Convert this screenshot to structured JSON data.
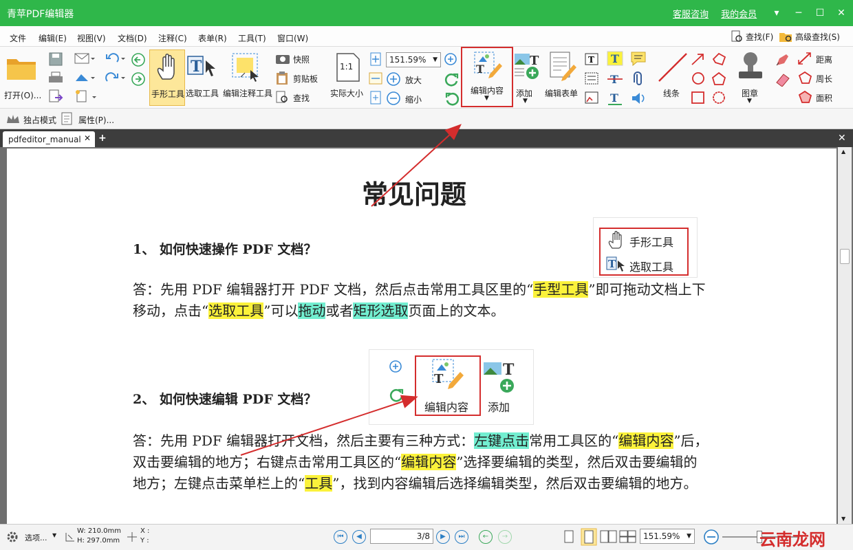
{
  "titlebar": {
    "app_title": "青苹PDF编辑器",
    "links": [
      "客服咨询",
      "我的会员"
    ],
    "dropdown": "▾",
    "minimize": "─",
    "maximize": "☐",
    "close": "✕"
  },
  "menu": {
    "items": [
      "文件",
      "编辑(E)",
      "视图(V)",
      "文档(D)",
      "注释(C)",
      "表单(R)",
      "工具(T)",
      "窗口(W)"
    ],
    "find": "查找(F)",
    "advanced_find": "高级查找(S)"
  },
  "toolbar": {
    "open": "打开(O)...",
    "hand_tool": "手形工具",
    "select_tool": "选取工具",
    "edit_annot_tool": "编辑注释工具",
    "snapshot": "快照",
    "clipboard": "剪贴板",
    "find": "查找",
    "actual_size": "实际大小",
    "actual_size_icon": "1:1",
    "zoom_value": "151.59%",
    "zoom_in": "放大",
    "zoom_out": "缩小",
    "edit_content": "编辑内容",
    "add": "添加",
    "edit_form": "编辑表单",
    "line": "线条",
    "stamp": "图章",
    "distance": "距离",
    "perimeter": "周长",
    "area": "面积"
  },
  "subbar": {
    "exclusive_mode": "独占模式",
    "properties": "属性(P)..."
  },
  "tabs": {
    "doc_name": "pdfeditor_manual",
    "close": "✕",
    "new": "+",
    "close_all": "✕"
  },
  "document": {
    "title": "常见问题",
    "q1": "1、  如何快速操作 PDF 文档？",
    "a1_parts": {
      "p1": "答：先用 PDF 编辑器打开 PDF 文档，然后点击常用工具区里的“",
      "h1": "手型工具",
      "p2": "”即可拖动文档上下移动，点击“",
      "h2": "选取工具",
      "p3": "”可以",
      "h3": "拖动",
      "p4": "或者",
      "h4": "矩形选取",
      "p5": "页面上的文本。"
    },
    "q2": "2、  如何快速编辑 PDF 文档？",
    "a2_parts": {
      "p1": "答：先用 PDF 编辑器打开文档，然后主要有三种方式：",
      "h1": "左键点击",
      "p2": "常用工具区的“",
      "h2": "编辑内容",
      "p3": "”后，双击要编辑的地方；右键点击常用工具区的“",
      "h3": "编辑内容",
      "p4": "”选择要编辑的类型，然后双击要编辑的地方；左键点击菜单栏上的“",
      "h4": "工具",
      "p5": "”，找到内容编辑后选择编辑类型，然后双击要编辑的地方。"
    },
    "inset1": {
      "hand": "手形工具",
      "select": "选取工具"
    },
    "inset2": {
      "edit": "编辑内容",
      "add": "添加"
    }
  },
  "status": {
    "options": "选项...",
    "width": "W: 210.0mm",
    "height": "H: 297.0mm",
    "x": "X :",
    "y": "Y :",
    "page": "3/8",
    "zoom": "151.59%",
    "watermark": "云南龙网"
  },
  "colors": {
    "title_green": "#2fb74a",
    "highlight_yellow": "#fbf23b",
    "highlight_green": "#72eed0",
    "callout_red": "#d42d2d",
    "accent_blue": "#2c7fc4"
  }
}
